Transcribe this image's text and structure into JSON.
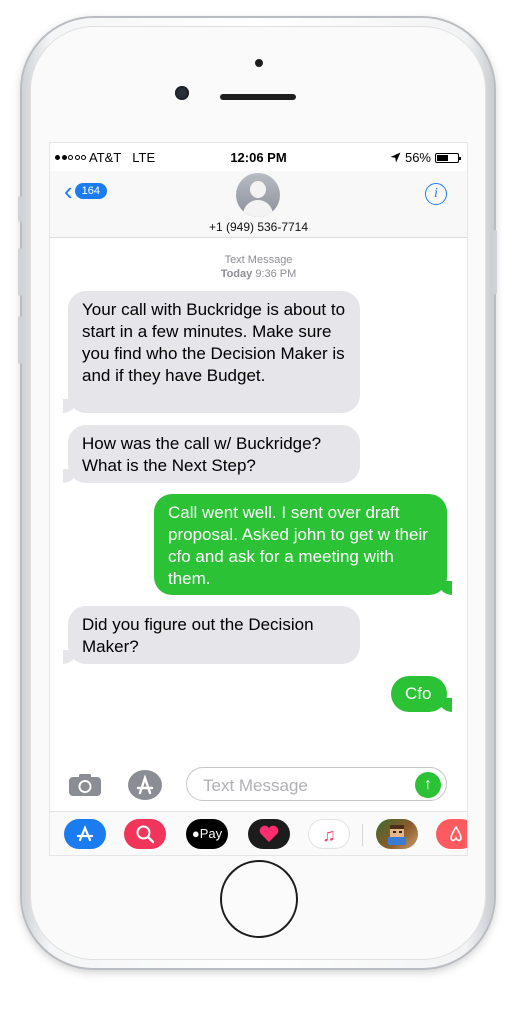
{
  "status_bar": {
    "carrier": "AT&T",
    "network": "LTE",
    "time": "12:06 PM",
    "location_icon": "location-arrow-icon",
    "battery_percent": "56%",
    "battery_level": 0.56
  },
  "nav": {
    "back_count": "164",
    "contact_number": "+1 (949) 536-7714"
  },
  "thread_meta": {
    "type_label": "Text Message",
    "day": "Today",
    "time": "9:36 PM"
  },
  "messages": [
    {
      "direction": "incoming",
      "text": "Your call with Buckridge is about to start in a few minutes.  Make sure you find who the Decision Maker is and if they have Budget."
    },
    {
      "direction": "incoming",
      "text": "How was the call w/ Buckridge? What is the Next Step?"
    },
    {
      "direction": "outgoing",
      "text": "Call went well.  I sent over draft proposal.  Asked john to get w their cfo and ask for a meeting with them."
    },
    {
      "direction": "incoming",
      "text": "Did you figure out the Decision Maker?"
    },
    {
      "direction": "outgoing",
      "text": "Cfo"
    }
  ],
  "composer": {
    "placeholder": "Text Message"
  },
  "app_tray": {
    "apps": [
      {
        "name": "app-store-icon",
        "label": "",
        "color": "#1b7cf2"
      },
      {
        "name": "web-search-icon",
        "label": "",
        "color": "#f0345a"
      },
      {
        "name": "apple-pay-icon",
        "label": "Pay",
        "color": "#000000"
      },
      {
        "name": "digital-touch-icon",
        "label": "",
        "color": "#1c1c1c"
      },
      {
        "name": "music-icon",
        "label": "",
        "color": "#ffffff"
      },
      {
        "name": "game-app-icon",
        "label": "",
        "color": "#6b4d2e"
      },
      {
        "name": "airbnb-icon",
        "label": "",
        "color": "#ff5a5f"
      }
    ]
  },
  "colors": {
    "ios_blue": "#1b7cf2",
    "outgoing_green": "#2bc236",
    "incoming_gray": "#e5e5ea"
  }
}
